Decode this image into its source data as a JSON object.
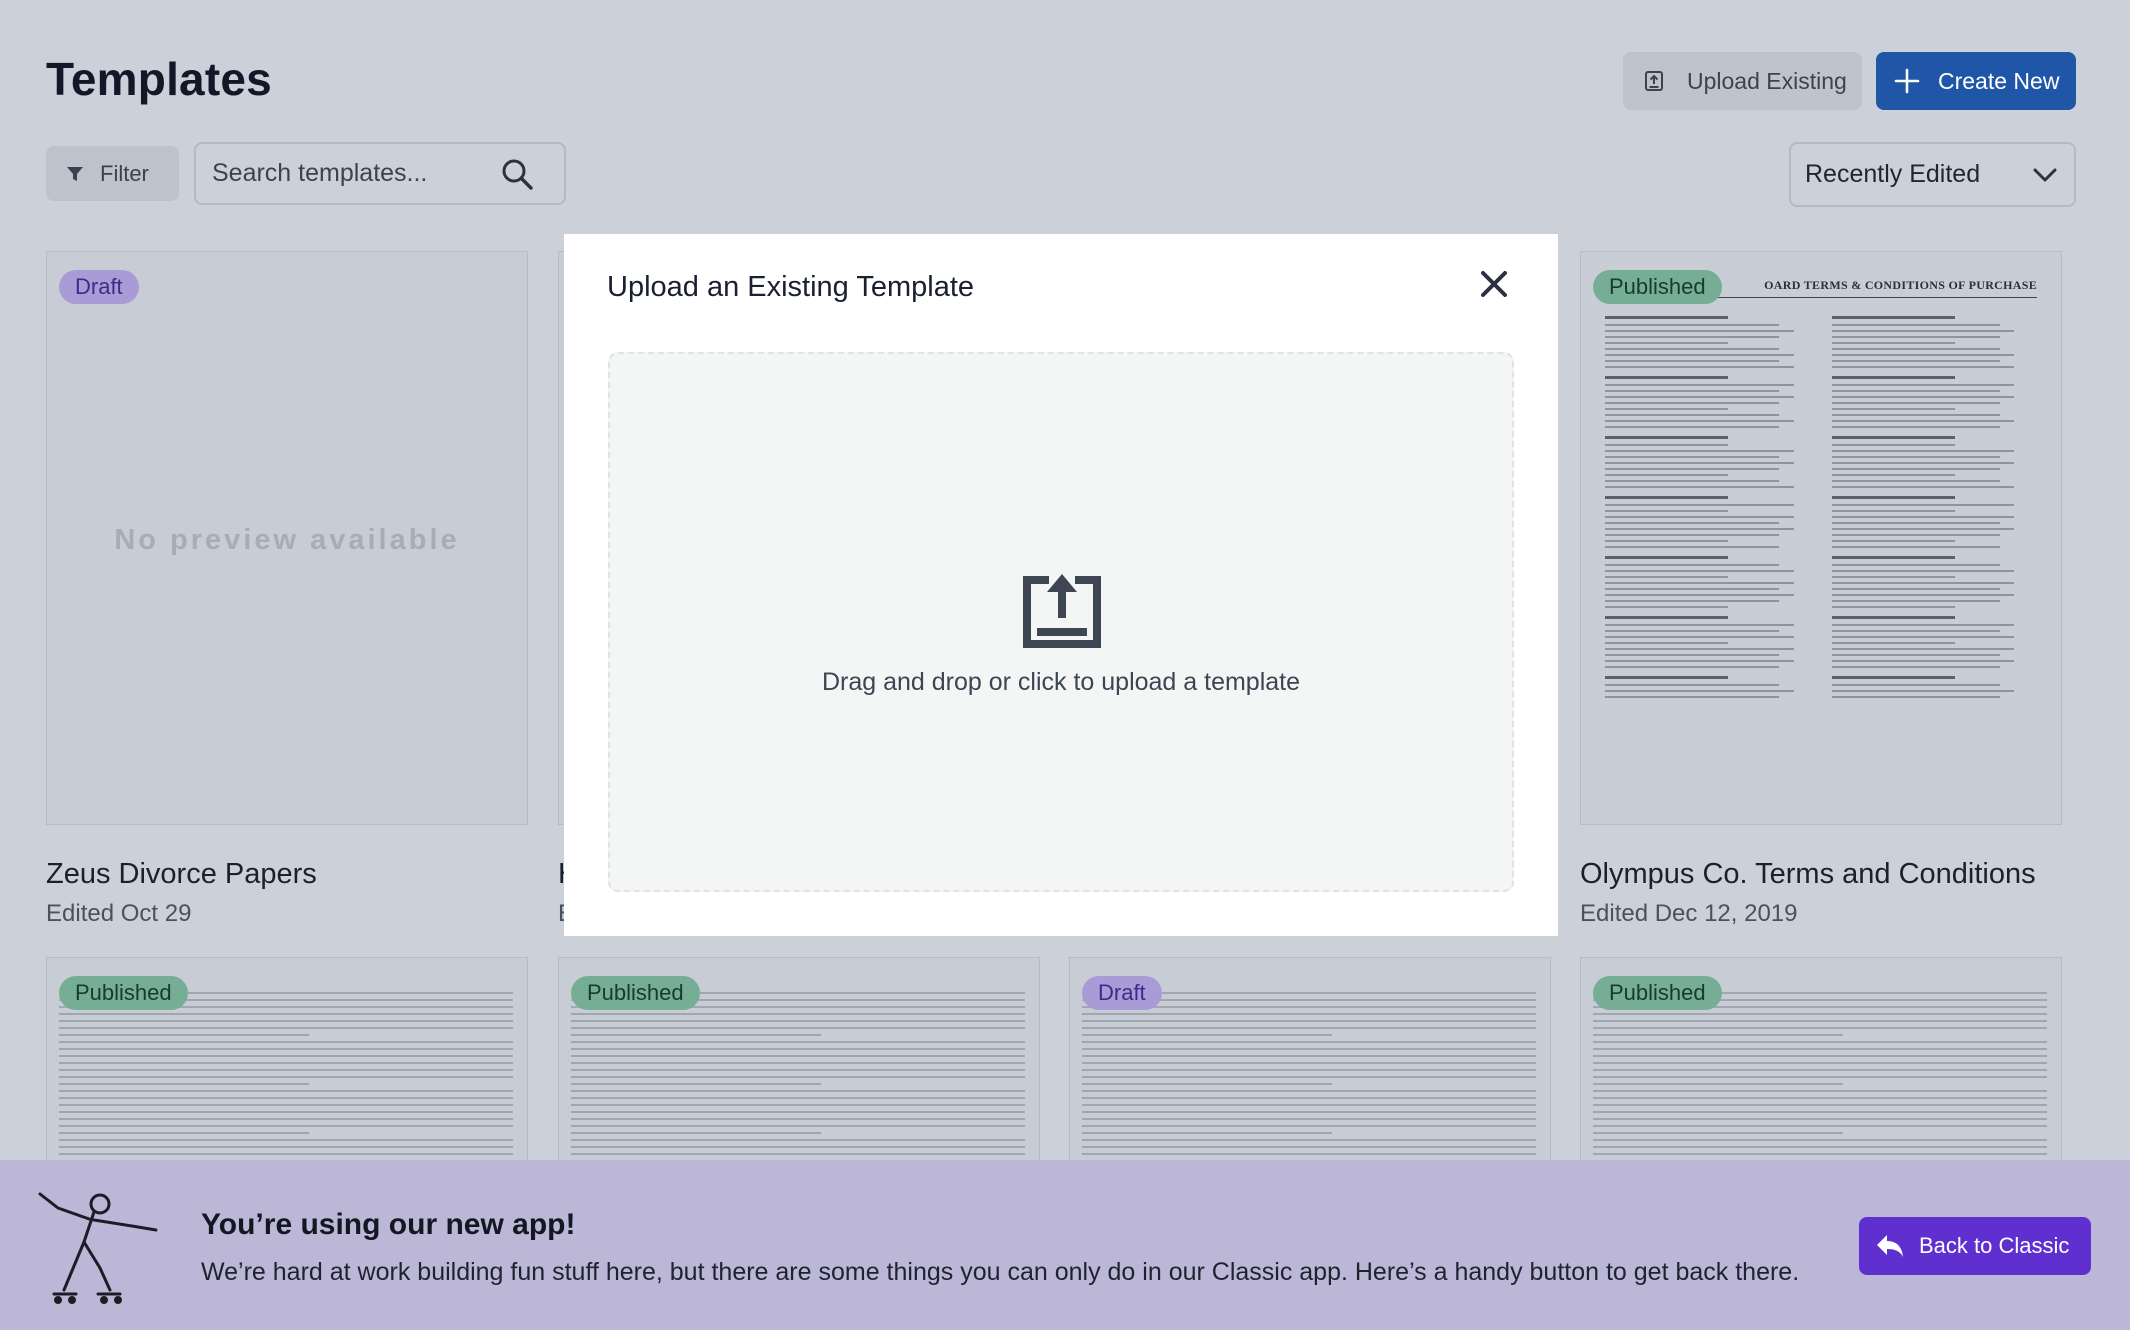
{
  "header": {
    "title": "Templates",
    "upload_label": "Upload Existing",
    "create_label": "Create New"
  },
  "toolbar": {
    "filter_label": "Filter",
    "search_placeholder": "Search templates...",
    "sort_value": "Recently Edited"
  },
  "cards_row1": [
    {
      "badge": "Draft",
      "title": "Zeus Divorce Papers",
      "date": "Edited Oct 29",
      "preview": "No preview available"
    },
    {
      "title": "H",
      "date": "E"
    },
    {
      "badge": "Published",
      "title": "Olympus Co. Terms and Conditions",
      "date": "Edited Dec 12, 2019",
      "doc_heading": "OARD TERMS & CONDITIONS OF PURCHASE"
    }
  ],
  "cards_row2": [
    {
      "badge": "Published"
    },
    {
      "badge": "Published"
    },
    {
      "badge": "Draft"
    },
    {
      "badge": "Published"
    }
  ],
  "modal": {
    "title": "Upload an Existing Template",
    "dropzone_text": "Drag and drop or click to upload a template"
  },
  "banner": {
    "title": "You’re using our new app!",
    "text": "We’re hard at work building fun stuff here, but there are some things you can only do in our Classic app. Here’s a handy button to get back there.",
    "button_label": "Back to Classic"
  },
  "colors": {
    "page_bg": "#ccd1d9",
    "primary": "#1f56a8",
    "banner_bg": "#bcb6d7",
    "classic_button": "#5f2fd0",
    "draft_badge": "#a99bd6",
    "published_badge": "#76ad95"
  }
}
